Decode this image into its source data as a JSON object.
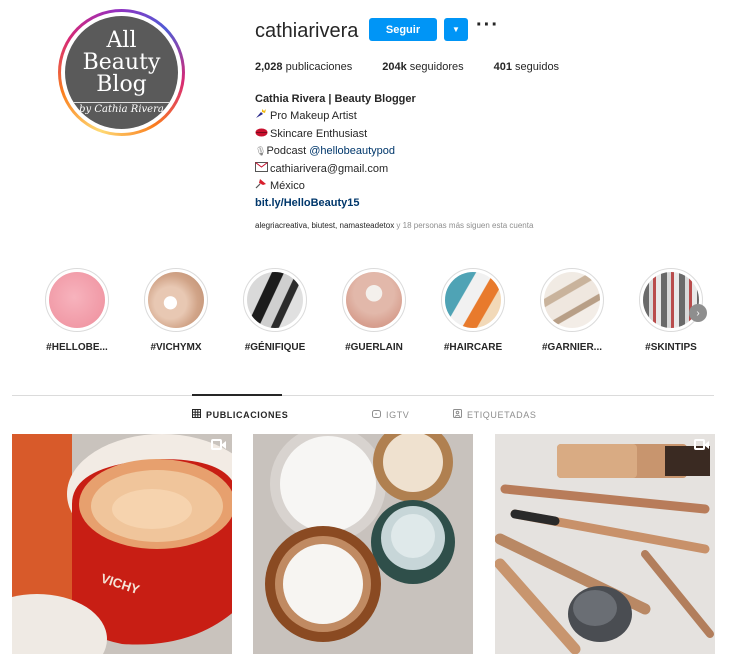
{
  "profile": {
    "avatar_text": [
      "All",
      "Beauty",
      "Blog"
    ],
    "avatar_signature": "by Cathia Rivera",
    "username": "cathiarivera",
    "follow_label": "Seguir",
    "stats": [
      {
        "count": "2,028",
        "label": " publicaciones"
      },
      {
        "count": "204k",
        "label": " seguidores"
      },
      {
        "count": "401",
        "label": " seguidos"
      }
    ],
    "bio": {
      "name": "Cathia Rivera | Beauty Blogger",
      "line1_text": "Pro Makeup Artist",
      "line2_text": "Skincare Enthusiast",
      "line3_prefix": "Podcast ",
      "line3_mention": "@hellobeautypod",
      "line4_text": "cathiarivera@gmail.com",
      "line5_text": "México",
      "website": "bit.ly/HelloBeauty15"
    },
    "followed_by": {
      "names": "alegriacreativa, biutest, namasteadetox",
      "suffix": " y 18 personas más siguen esta cuenta"
    }
  },
  "highlights": [
    {
      "label": "#HELLOBE..."
    },
    {
      "label": "#VICHYMX"
    },
    {
      "label": "#GÉNIFIQUE"
    },
    {
      "label": "#GUERLAIN"
    },
    {
      "label": "#HAIRCARE"
    },
    {
      "label": "#GARNIER..."
    },
    {
      "label": "#SKINTIPS"
    }
  ],
  "tabs": [
    {
      "label": "PUBLICACIONES",
      "icon": "grid-icon",
      "active": true
    },
    {
      "label": "IGTV",
      "icon": "igtv-icon",
      "active": false
    },
    {
      "label": "ETIQUETADAS",
      "icon": "tagged-icon",
      "active": false
    }
  ],
  "posts": [
    {
      "subject": "red-skincare-jar",
      "has_video": true
    },
    {
      "subject": "cream-jars",
      "has_video": false
    },
    {
      "subject": "gold-makeup-pens",
      "has_video": true
    }
  ],
  "colors": {
    "accent": "#0095f6",
    "text": "#262626",
    "muted": "#8e8e8e",
    "link": "#00376b",
    "divider": "#dbdbdb"
  }
}
